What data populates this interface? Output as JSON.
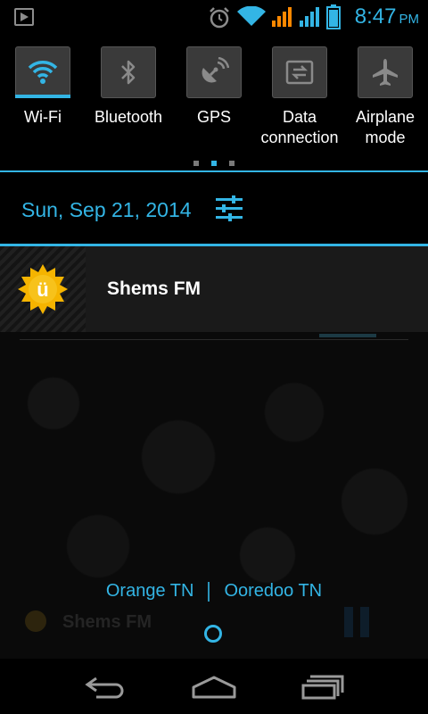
{
  "status_bar": {
    "time": "8:47",
    "ampm": "PM",
    "icons": [
      "play-store-notification-icon",
      "alarm-icon",
      "wifi-signal-icon",
      "cell-signal-icon-1",
      "cell-signal-icon-2",
      "battery-icon"
    ]
  },
  "quick_settings": {
    "tiles": [
      {
        "label": "Wi-Fi",
        "icon": "wifi-icon",
        "on": true
      },
      {
        "label": "Bluetooth",
        "icon": "bluetooth-icon",
        "on": false
      },
      {
        "label": "GPS",
        "icon": "gps-icon",
        "on": false
      },
      {
        "label": "Data\nconnection",
        "icon": "data-connection-icon",
        "on": false
      },
      {
        "label": "Airplane\nmode",
        "icon": "airplane-icon",
        "on": false
      }
    ],
    "page_indicator": {
      "pages": 3,
      "active": 2
    }
  },
  "header": {
    "date": "Sun, Sep 21, 2014",
    "settings_icon": "settings-sliders-icon"
  },
  "notification": {
    "title": "Shems FM",
    "icon": "shems-fm-logo-icon"
  },
  "background": {
    "ghost_app_name": "Shems FM"
  },
  "carriers": {
    "left": "Orange TN",
    "right": "Ooredoo TN"
  },
  "nav": {
    "back": "back-icon",
    "home": "home-icon",
    "recents": "recents-icon"
  },
  "colors": {
    "accent": "#33b5e5",
    "tile_bg": "#3a3a3a",
    "notification_bg": "#1a1a1a"
  }
}
